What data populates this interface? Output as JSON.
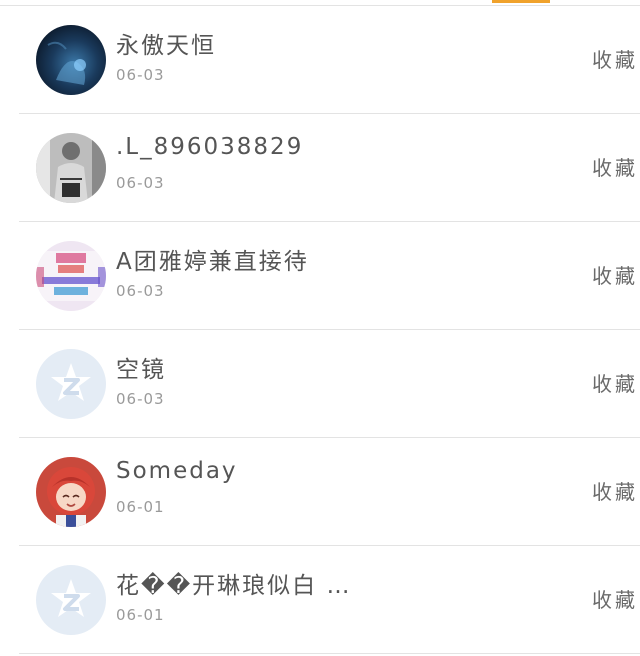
{
  "favorites": [
    {
      "name": "永傲天恒",
      "date": "06-03",
      "action": "收藏",
      "avatar": "avatar-dark-blue"
    },
    {
      "name": ".L_896038829",
      "date": "06-03",
      "action": "收藏",
      "avatar": "avatar-person-photo"
    },
    {
      "name": "A团雅婷兼直接待",
      "date": "06-03",
      "action": "收藏",
      "avatar": "avatar-banner-text"
    },
    {
      "name": "空镜",
      "date": "06-03",
      "action": "收藏",
      "avatar": "avatar-default-z"
    },
    {
      "name": "Someday",
      "date": "06-01",
      "action": "收藏",
      "avatar": "avatar-anime-girl"
    },
    {
      "name": "花��开琳琅似白 …",
      "date": "06-01",
      "action": "收藏",
      "avatar": "avatar-default-z"
    }
  ],
  "colors": {
    "accent": "#f0a22c",
    "divider": "#e3e3e3",
    "name_text": "#555555",
    "date_text": "#9a9a9a",
    "action_text": "#6a6a6a",
    "default_avatar_bg": "#e4ecf5"
  }
}
